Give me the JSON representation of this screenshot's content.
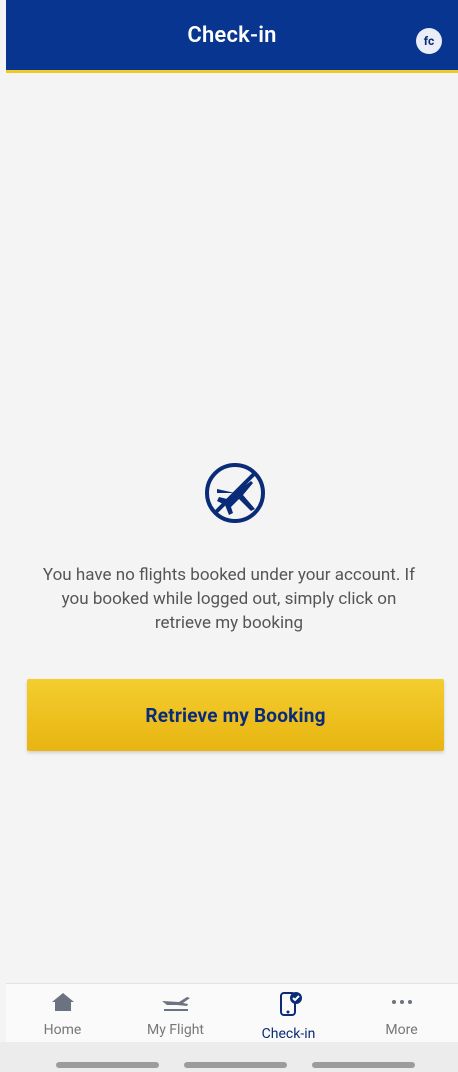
{
  "header": {
    "title": "Check-in",
    "avatar_text": "fc"
  },
  "content": {
    "message": "You have no flights booked under your account. If you booked while logged out, simply click on retrieve my booking",
    "button_label": "Retrieve my Booking"
  },
  "nav": {
    "items": [
      {
        "label": "Home",
        "icon": "home-icon"
      },
      {
        "label": "My Flight",
        "icon": "plane-icon"
      },
      {
        "label": "Check-in",
        "icon": "phone-check-icon",
        "active": true
      },
      {
        "label": "More",
        "icon": "more-icon"
      }
    ]
  },
  "colors": {
    "primary": "#073590",
    "accent": "#f3cd2f",
    "navy_text": "#0a2b78"
  }
}
